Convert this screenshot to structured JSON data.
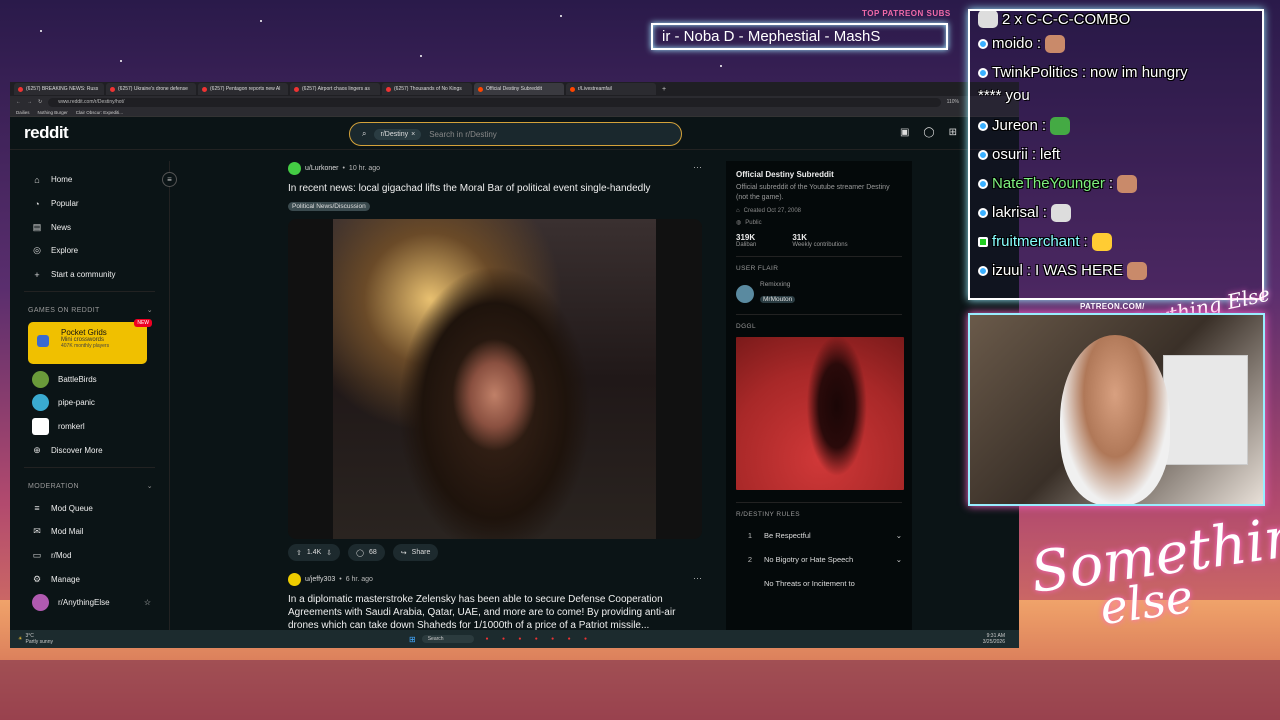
{
  "overlay": {
    "patreon_title": "TOP PATREON SUBS",
    "patreon_scroll": "ir - Noba D - Mephestial - MashS",
    "patreon_url": "PATREON.COM/",
    "script_top": "Anything Else",
    "script_bottom1": "Something",
    "script_bottom2": "else"
  },
  "browser": {
    "tabs": [
      "(6257) BREAKING NEWS: Russ",
      "(6257) Ukraine's drone defense",
      "(6257) Pentagon reports new Al",
      "(6257) Airport chaos lingers as",
      "(6257) Thousands of No Kings",
      "Official Destiny Subreddit",
      "r/Livestreamfail"
    ],
    "url": "www.reddit.com/r/Destiny/hot/",
    "zoom": "110%",
    "bookmarks": [
      "Dailies",
      "Nothing Burger",
      "Clair Obscur: Expediti..."
    ]
  },
  "reddit": {
    "logo": "reddit",
    "search_chip": "r/Destiny",
    "search_placeholder": "Search in r/Destiny",
    "nav": [
      "Home",
      "Popular",
      "News",
      "Explore",
      "Start a community"
    ],
    "games_heading": "GAMES ON REDDIT",
    "game_card": {
      "title": "Pocket Grids",
      "subtitle": "Mini crosswords",
      "players": "407K monthly players",
      "badge": "NEW"
    },
    "games": [
      "BattleBirds",
      "pipe-panic",
      "romkerl",
      "Discover More"
    ],
    "moderation_heading": "MODERATION",
    "mod_items": [
      "Mod Queue",
      "Mod Mail",
      "r/Mod",
      "Manage",
      "r/AnythingElse"
    ],
    "post1": {
      "user": "u/Lurkoner",
      "time": "10 hr. ago",
      "title": "In recent news: local gigachad lifts the Moral Bar of political event single-handedly",
      "flair": "Political News/Discussion",
      "votes": "1.4K",
      "comments": "68",
      "share": "Share"
    },
    "post2": {
      "user": "u/jeffy303",
      "time": "6 hr. ago",
      "title": "In a diplomatic masterstroke Zelensky has been able to secure Defense Cooperation Agreements with Saudi Arabia, Qatar, UAE, and more are to come! By providing anti-air drones which can take down Shaheds for 1/1000th of a price of a Patriot missile..."
    },
    "sidebar_right": {
      "name": "Official Destiny Subreddit",
      "desc": "Official subreddit of the Youtube streamer Destiny (not the game).",
      "created": "Created Oct 27, 2008",
      "public": "Public",
      "stat1_n": "319K",
      "stat1_l": "Daliban",
      "stat2_n": "31K",
      "stat2_l": "Weekly contributions",
      "user_flair_heading": "USER FLAIR",
      "flair_name": "Remixxing",
      "flair_tag": "MrMouton",
      "dggl_heading": "DGGL",
      "rules_heading": "R/DESTINY RULES",
      "rules": [
        "Be Respectful",
        "No Bigotry or Hate Speech",
        "No Threats or Incitement to"
      ]
    }
  },
  "taskbar": {
    "weather_temp": "3°C",
    "weather_desc": "Partly sunny",
    "search": "Search",
    "time": "9:31 AM",
    "date": "3/25/2026"
  },
  "chat": {
    "combo": "2 x C-C-C-COMBO",
    "messages": [
      {
        "user": "moido",
        "text": ""
      },
      {
        "user": "TwinkPolitics",
        "text": "now im hungry"
      },
      {
        "user": "Jureon",
        "text": ""
      },
      {
        "user": "osurii",
        "text": "left"
      },
      {
        "user": "NateTheYounger",
        "text": ""
      },
      {
        "user": "lakrisal",
        "text": ""
      },
      {
        "user": "fruitmerchant",
        "text": ""
      },
      {
        "user": "izuul",
        "text": "I WAS HERE"
      }
    ],
    "cont": "**** you"
  },
  "colors": {
    "accent": "#d4a23a",
    "reddit_bg": "#0b1416",
    "chat_border": "#ffffff",
    "cam_glow": "#ff66cc"
  }
}
